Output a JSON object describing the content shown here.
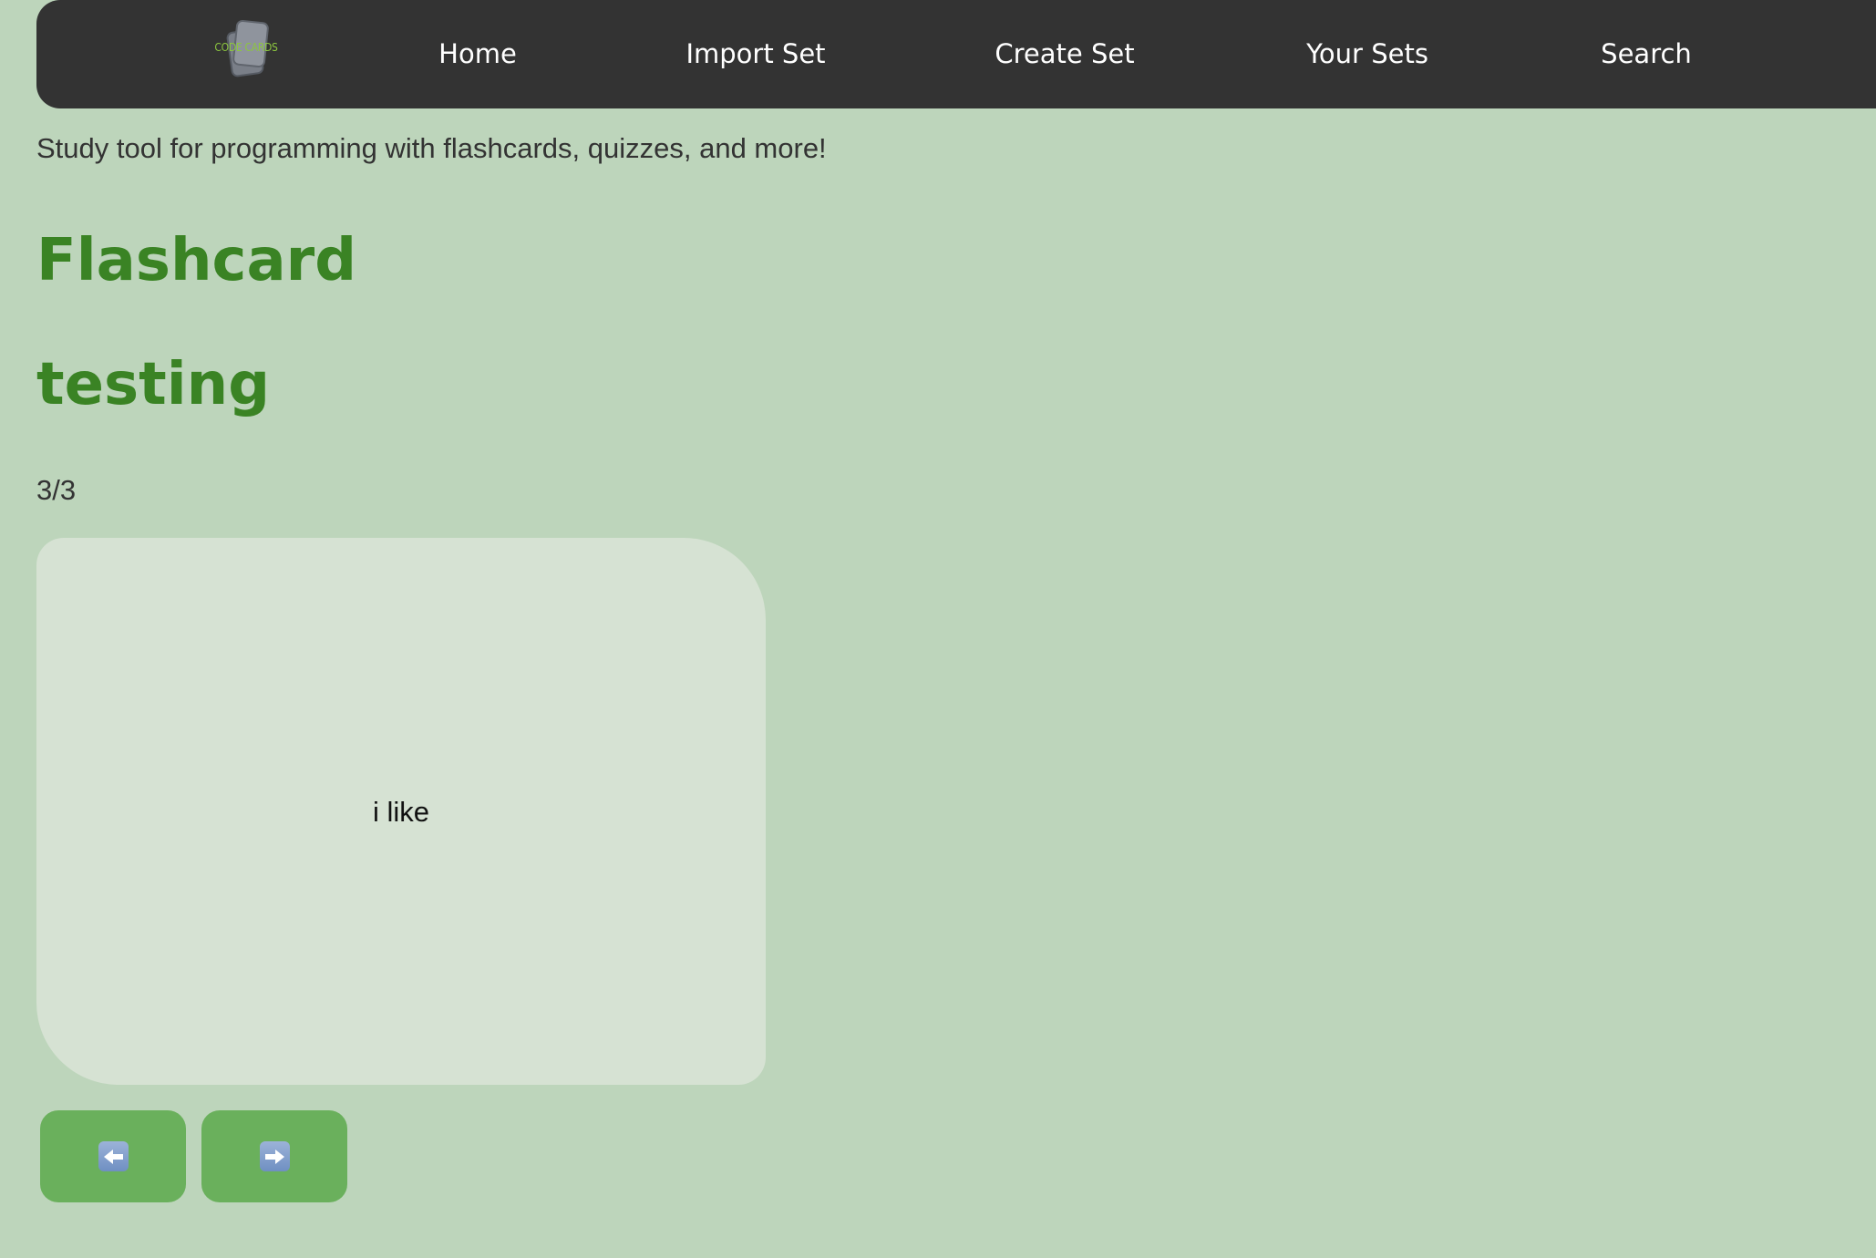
{
  "nav": {
    "logo_text": "CODE CARDS",
    "links": [
      "Home",
      "Import Set",
      "Create Set",
      "Your Sets",
      "Search"
    ]
  },
  "subtitle": "Study tool for programming with flashcards, quizzes, and more!",
  "page_title": "Flashcard",
  "set_name": "testing",
  "counter": "3/3",
  "card": {
    "text": "i like"
  },
  "buttons": {
    "prev_icon": "left-arrow-icon",
    "next_icon": "right-arrow-icon"
  },
  "colors": {
    "background": "#bdd5bb",
    "navbar": "#333333",
    "accent_green": "#3a8324",
    "button_green": "#6ab05c",
    "card": "#d6e2d3",
    "logo_green": "#8cc63f"
  }
}
